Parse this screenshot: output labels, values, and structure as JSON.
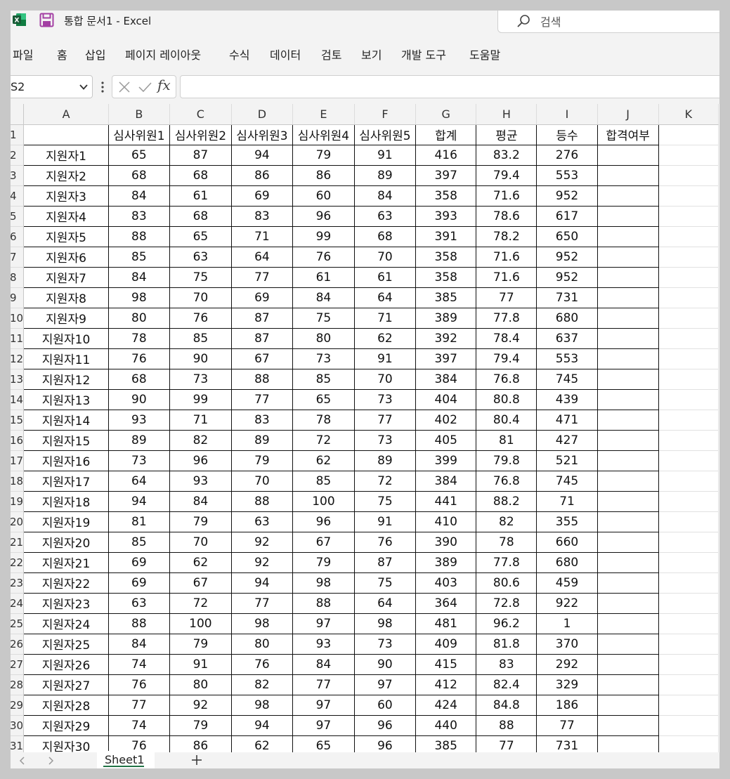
{
  "app": {
    "title": "통합 문서1  -  Excel",
    "search_placeholder": "검색",
    "accent_color": "#217346"
  },
  "menu": [
    "파일",
    "홈",
    "삽입",
    "페이지 레이아웃",
    "수식",
    "데이터",
    "검토",
    "보기",
    "개발 도구",
    "도움말"
  ],
  "formula_bar": {
    "name_box": "S2",
    "fx": "fx",
    "value": ""
  },
  "columns": [
    "A",
    "B",
    "C",
    "D",
    "E",
    "F",
    "G",
    "H",
    "I",
    "J",
    "K"
  ],
  "header_row": [
    "",
    "심사위원1",
    "심사위원2",
    "심사위원3",
    "심사위원4",
    "심사위원5",
    "합계",
    "평균",
    "등수",
    "합격여부"
  ],
  "rows": [
    [
      "지원자1",
      "65",
      "87",
      "94",
      "79",
      "91",
      "416",
      "83.2",
      "276",
      ""
    ],
    [
      "지원자2",
      "68",
      "68",
      "86",
      "86",
      "89",
      "397",
      "79.4",
      "553",
      ""
    ],
    [
      "지원자3",
      "84",
      "61",
      "69",
      "60",
      "84",
      "358",
      "71.6",
      "952",
      ""
    ],
    [
      "지원자4",
      "83",
      "68",
      "83",
      "96",
      "63",
      "393",
      "78.6",
      "617",
      ""
    ],
    [
      "지원자5",
      "88",
      "65",
      "71",
      "99",
      "68",
      "391",
      "78.2",
      "650",
      ""
    ],
    [
      "지원자6",
      "85",
      "63",
      "64",
      "76",
      "70",
      "358",
      "71.6",
      "952",
      ""
    ],
    [
      "지원자7",
      "84",
      "75",
      "77",
      "61",
      "61",
      "358",
      "71.6",
      "952",
      ""
    ],
    [
      "지원자8",
      "98",
      "70",
      "69",
      "84",
      "64",
      "385",
      "77",
      "731",
      ""
    ],
    [
      "지원자9",
      "80",
      "76",
      "87",
      "75",
      "71",
      "389",
      "77.8",
      "680",
      ""
    ],
    [
      "지원자10",
      "78",
      "85",
      "87",
      "80",
      "62",
      "392",
      "78.4",
      "637",
      ""
    ],
    [
      "지원자11",
      "76",
      "90",
      "67",
      "73",
      "91",
      "397",
      "79.4",
      "553",
      ""
    ],
    [
      "지원자12",
      "68",
      "73",
      "88",
      "85",
      "70",
      "384",
      "76.8",
      "745",
      ""
    ],
    [
      "지원자13",
      "90",
      "99",
      "77",
      "65",
      "73",
      "404",
      "80.8",
      "439",
      ""
    ],
    [
      "지원자14",
      "93",
      "71",
      "83",
      "78",
      "77",
      "402",
      "80.4",
      "471",
      ""
    ],
    [
      "지원자15",
      "89",
      "82",
      "89",
      "72",
      "73",
      "405",
      "81",
      "427",
      ""
    ],
    [
      "지원자16",
      "73",
      "96",
      "79",
      "62",
      "89",
      "399",
      "79.8",
      "521",
      ""
    ],
    [
      "지원자17",
      "64",
      "93",
      "70",
      "85",
      "72",
      "384",
      "76.8",
      "745",
      ""
    ],
    [
      "지원자18",
      "94",
      "84",
      "88",
      "100",
      "75",
      "441",
      "88.2",
      "71",
      ""
    ],
    [
      "지원자19",
      "81",
      "79",
      "63",
      "96",
      "91",
      "410",
      "82",
      "355",
      ""
    ],
    [
      "지원자20",
      "85",
      "70",
      "92",
      "67",
      "76",
      "390",
      "78",
      "660",
      ""
    ],
    [
      "지원자21",
      "69",
      "62",
      "92",
      "79",
      "87",
      "389",
      "77.8",
      "680",
      ""
    ],
    [
      "지원자22",
      "69",
      "67",
      "94",
      "98",
      "75",
      "403",
      "80.6",
      "459",
      ""
    ],
    [
      "지원자23",
      "63",
      "72",
      "77",
      "88",
      "64",
      "364",
      "72.8",
      "922",
      ""
    ],
    [
      "지원자24",
      "88",
      "100",
      "98",
      "97",
      "98",
      "481",
      "96.2",
      "1",
      ""
    ],
    [
      "지원자25",
      "84",
      "79",
      "80",
      "93",
      "73",
      "409",
      "81.8",
      "370",
      ""
    ],
    [
      "지원자26",
      "74",
      "91",
      "76",
      "84",
      "90",
      "415",
      "83",
      "292",
      ""
    ],
    [
      "지원자27",
      "76",
      "80",
      "82",
      "77",
      "97",
      "412",
      "82.4",
      "329",
      ""
    ],
    [
      "지원자28",
      "77",
      "92",
      "98",
      "97",
      "60",
      "424",
      "84.8",
      "186",
      ""
    ],
    [
      "지원자29",
      "74",
      "79",
      "94",
      "97",
      "96",
      "440",
      "88",
      "77",
      ""
    ],
    [
      "지원자30",
      "76",
      "86",
      "62",
      "65",
      "96",
      "385",
      "77",
      "731",
      ""
    ]
  ],
  "tabs": {
    "sheets": [
      "Sheet1"
    ],
    "active": "Sheet1",
    "add_icon": "plus-icon"
  }
}
